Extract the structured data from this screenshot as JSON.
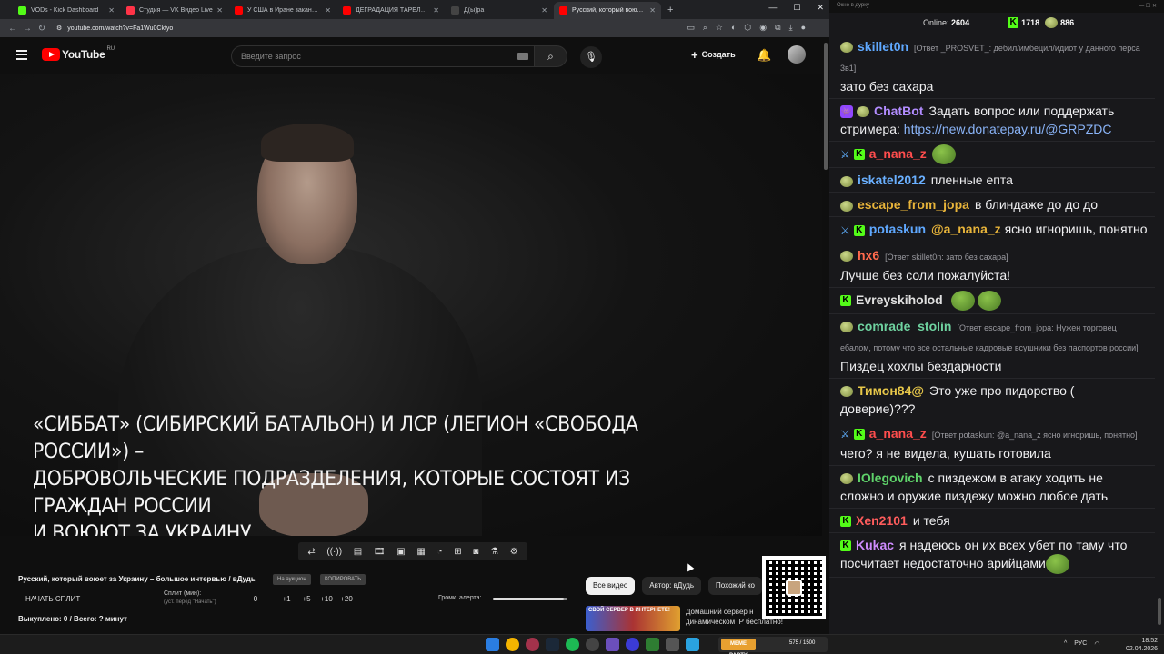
{
  "browser": {
    "tabs": [
      {
        "label": "VODs - Kick Dashboard",
        "color": "#53fc18"
      },
      {
        "label": "Студия — VK Видео Live",
        "color": "#ff3347"
      },
      {
        "label": "У США в Иране заканчиваются",
        "color": "#ff0000"
      },
      {
        "label": "ДЕГРАДАЦИЯ ТАРЕЛОЧНИЦ",
        "color": "#ff0000"
      },
      {
        "label": "Д(ы)ра",
        "color": "#444444"
      },
      {
        "label": "Русский, который воюет з",
        "color": "#ff0000"
      }
    ],
    "url": "youtube.com/watch?v=Fa1Wu0Cktyo"
  },
  "youtube": {
    "logo_text": "YouTube",
    "region": "RU",
    "search_placeholder": "Введите запрос",
    "create_label": "Создать"
  },
  "video": {
    "caption": "«СИББАТ» (СИБИРСКИЙ БАТАЛЬОН) И ЛСР (ЛЕГИОН «СВОБОДА РОССИИ») –\nДОБРОВОЛЬЧЕСКИЕ ПОДРАЗДЕЛЕНИЯ, КОТОРЫЕ СОСТОЯТ ИЗ ГРАЖДАН РОССИИ\nИ ВОЮЮТ ЗА УКРАИНУ"
  },
  "panel": {
    "video_title": "Русский, который воюет за Украину – большое интервью / вДудь",
    "btn_auction": "На аукцион",
    "btn_copy": "КОПИРОВАТЬ",
    "start_split": "НАЧАТЬ СПЛИТ",
    "split_label": "Сплит (мин):",
    "split_sub": "(уст. перед \"Начать\")",
    "steps": [
      "0",
      "+1",
      "+5",
      "+10",
      "+20"
    ],
    "alert_label": "Громк. алерта:",
    "alert_level": 0.95,
    "bought": "Выкуплено: 0 / Всего: ? минут"
  },
  "filters": {
    "chips": [
      "Все видео",
      "Автор: вДудь",
      "Похожий ко"
    ],
    "promo_badge": "СВОЙ СЕРВЕР В ИНТЕРНЕТЕ!",
    "promo_text": "Домашний сервер н динамическом IP бесплатно!"
  },
  "chat": {
    "window_title": "Окно в дурку",
    "online_label": "Online:",
    "online_count": "2604",
    "kick_count": "1718",
    "frog_count": "886",
    "messages": [
      {
        "user": "skillet0n",
        "color": "#5fa8ff",
        "badges": [
          "frog"
        ],
        "reply": "[Ответ _PROSVET_: дебил/имбецил/идиот у данного перса 3в1]",
        "text": "зато без сахара"
      },
      {
        "user": "ChatBot",
        "color": "#b28cff",
        "badges": [
          "bot",
          "frog"
        ],
        "reply": "",
        "text": "Задать вопрос или поддержать стримера:",
        "link": "https://new.donatepay.ru/@GRPZDC"
      },
      {
        "user": "a_nana_z",
        "color": "#ff4d4d",
        "badges": [
          "sword",
          "kick"
        ],
        "reply": "",
        "text": "",
        "emote": true
      },
      {
        "user": "iskatel2012",
        "color": "#6ab0ff",
        "badges": [
          "frog"
        ],
        "reply": "",
        "text": "пленные епта"
      },
      {
        "user": "escape_from_jopa",
        "color": "#e8b43a",
        "badges": [
          "frog"
        ],
        "reply": "",
        "text": "в блиндаже до до до"
      },
      {
        "user": "potaskun",
        "color": "#5fa8ff",
        "badges": [
          "sword",
          "kick"
        ],
        "reply": "",
        "mention": "@a_nana_z",
        "text": "ясно игноришь, понятно"
      },
      {
        "user": "hx6",
        "color": "#ff6a4d",
        "badges": [
          "frog"
        ],
        "reply": "[Ответ skillet0n: зато без сахара]",
        "text": "Лучше без соли пожалуйста!"
      },
      {
        "user": "Evreyskiholod",
        "color": "#e0e0e0",
        "badges": [
          "kick"
        ],
        "reply": "",
        "text": "",
        "emote2": true
      },
      {
        "user": "comrade_stolin",
        "color": "#6fd3a0",
        "badges": [
          "frog"
        ],
        "reply": "[Ответ escape_from_jopa: Нужен торговец ебалом, потому что все остальные кадровые всушники без паспортов россии]",
        "text": "Пиздец хохлы бездарности"
      },
      {
        "user": "Тимон84@",
        "color": "#e8c84a",
        "badges": [
          "frog"
        ],
        "reply": "",
        "text": "Это уже про пидорство ( доверие)???"
      },
      {
        "user": "a_nana_z",
        "color": "#ff4d4d",
        "badges": [
          "sword",
          "kick"
        ],
        "reply": "[Ответ potaskun: @a_nana_z ясно игноришь, понятно]",
        "text": "чего? я не видела, кушать готовила"
      },
      {
        "user": "IOlegovich",
        "color": "#5fd36a",
        "badges": [
          "frog"
        ],
        "reply": "",
        "text": "с пиздежом в атаку ходить не сложно и оружие пиздежу можно любое дать"
      },
      {
        "user": "Xen2101",
        "color": "#ff5c5c",
        "badges": [
          "kick"
        ],
        "reply": "",
        "text": "и тебя"
      },
      {
        "user": "Kukac",
        "color": "#cf8cff",
        "badges": [
          "kick"
        ],
        "reply": "",
        "text": "я надеюсь он их всех убет по таму что посчитает недостаточно арийцами",
        "emote3": true
      }
    ]
  },
  "taskbar": {
    "meme_label": "MEME PARTY",
    "meme_count": "575 / 1500",
    "lang": "РУС",
    "time": "18:52",
    "date": "02.04.2026"
  }
}
